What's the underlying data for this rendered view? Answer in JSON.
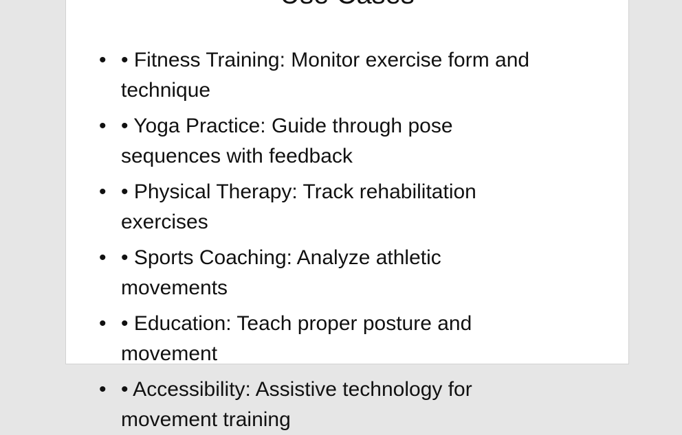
{
  "slide": {
    "title": "Use Cases",
    "bullet_marker": "•",
    "items": [
      {
        "line1": "• Fitness Training: Monitor exercise form and",
        "line2": "technique"
      },
      {
        "line1": "• Yoga Practice: Guide through pose",
        "line2": "sequences with feedback"
      },
      {
        "line1": "• Physical Therapy: Track rehabilitation",
        "line2": "exercises"
      },
      {
        "line1": "• Sports Coaching: Analyze athletic",
        "line2": "movements"
      },
      {
        "line1": "• Education: Teach proper posture and",
        "line2": "movement"
      },
      {
        "line1": "• Accessibility: Assistive technology for",
        "line2": "movement training"
      }
    ]
  }
}
